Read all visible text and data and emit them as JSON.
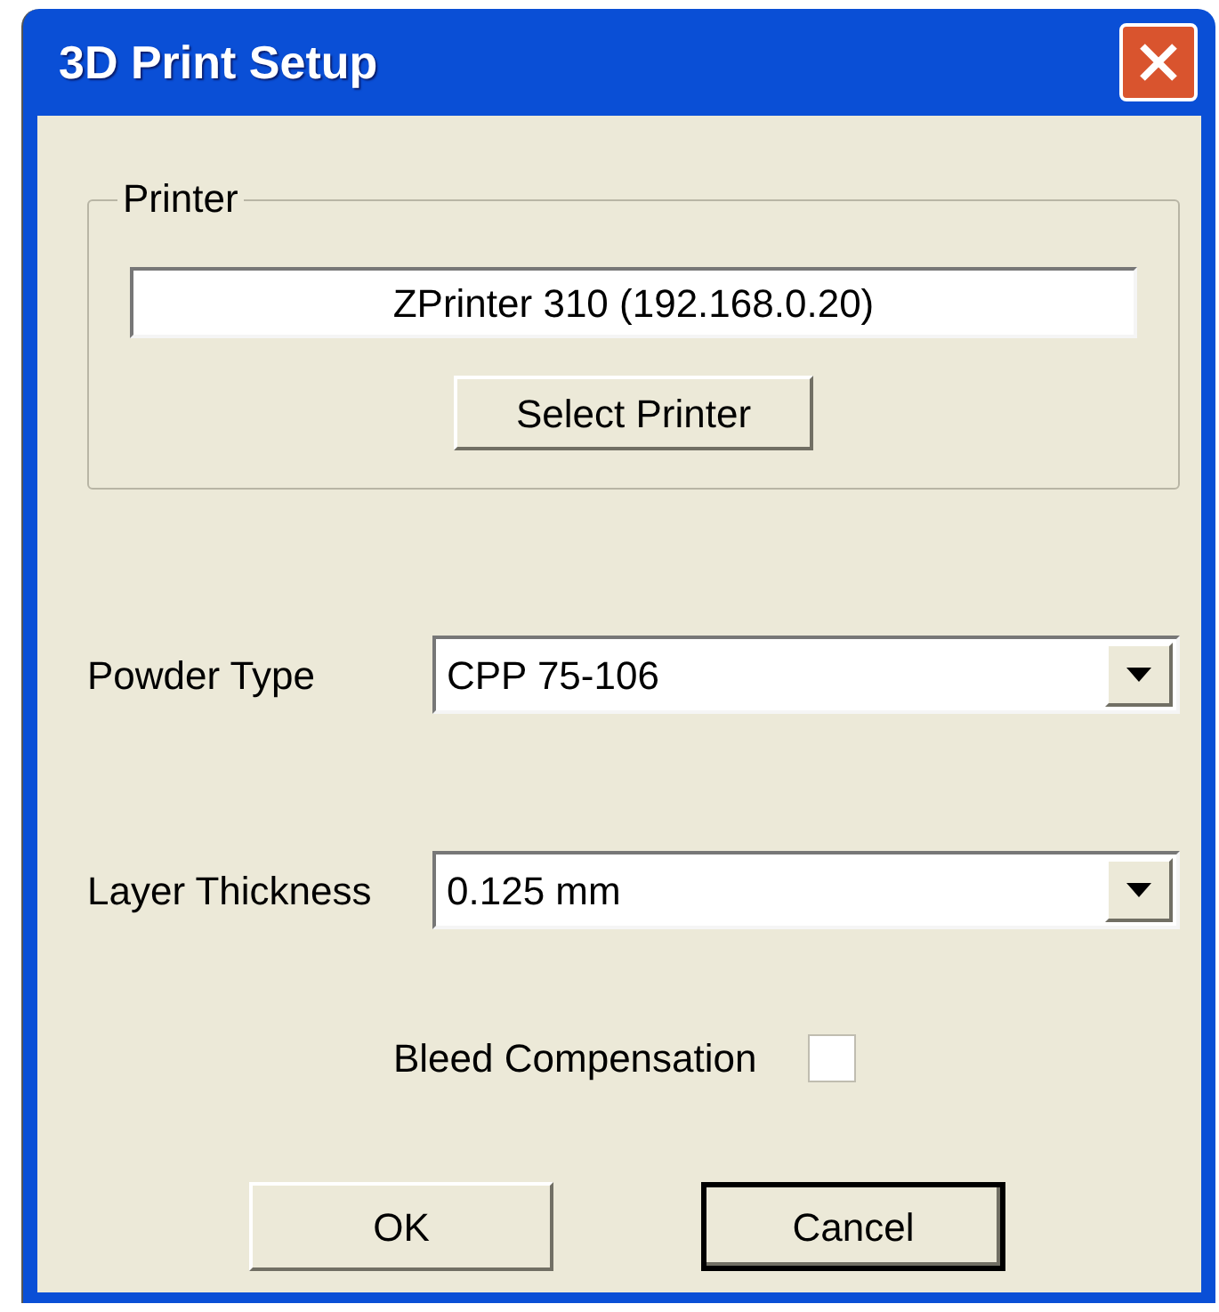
{
  "window": {
    "title": "3D Print Setup"
  },
  "printer_group": {
    "label": "Printer",
    "printer_name": "ZPrinter 310 (192.168.0.20)",
    "button": "Select Printer"
  },
  "fields": [
    {
      "label": "Powder Type",
      "value": "CPP 75-106"
    },
    {
      "label": "Layer Thickness",
      "value": "0.125 mm"
    }
  ],
  "bleed_compensation": {
    "label": "Bleed Compensation",
    "checked": false
  },
  "buttons": [
    {
      "label": "OK",
      "default": false
    },
    {
      "label": "Cancel",
      "default": true
    }
  ]
}
